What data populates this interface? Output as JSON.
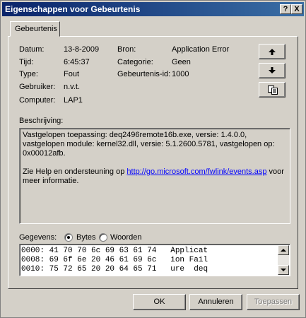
{
  "window": {
    "title": "Eigenschappen voor Gebeurtenis",
    "help_button": "?",
    "close_button": "X"
  },
  "tab": {
    "label": "Gebeurtenis"
  },
  "fields": {
    "datum_label": "Datum:",
    "datum_value": "13-8-2009",
    "tijd_label": "Tijd:",
    "tijd_value": "6:45:37",
    "type_label": "Type:",
    "type_value": "Fout",
    "gebruiker_label": "Gebruiker:",
    "gebruiker_value": "n.v.t.",
    "computer_label": "Computer:",
    "computer_value": "LAP1",
    "bron_label": "Bron:",
    "bron_value": "Application Error",
    "categorie_label": "Categorie:",
    "categorie_value": "Geen",
    "id_label": "Gebeurtenis-id:",
    "id_value": "1000"
  },
  "side_buttons": {
    "up_icon": "arrow-up-icon",
    "down_icon": "arrow-down-icon",
    "copy_icon": "copy-icon"
  },
  "description": {
    "label": "Beschrijving:",
    "line1": "Vastgelopen toepassing: deq2496remote16b.exe, versie: 1.4.0.0, vastgelopen module: kernel32.dll, versie: 5.1.2600.5781, vastgelopen op: 0x00012afb.",
    "help_prefix": "Zie Help en ondersteuning op ",
    "help_link": "http://go.microsoft.com/fwlink/events.asp",
    "help_suffix": " voor meer informatie."
  },
  "data": {
    "label": "Gegevens:",
    "bytes_label": "Bytes",
    "words_label": "Woorden",
    "selected": "Bytes",
    "rows": [
      "0000: 41 70 70 6c 69 63 61 74   Applicat",
      "0008: 69 6f 6e 20 46 61 69 6c   ion Fail",
      "0010: 75 72 65 20 20 64 65 71   ure  deq"
    ]
  },
  "buttons": {
    "ok": "OK",
    "cancel": "Annuleren",
    "apply": "Toepassen"
  }
}
